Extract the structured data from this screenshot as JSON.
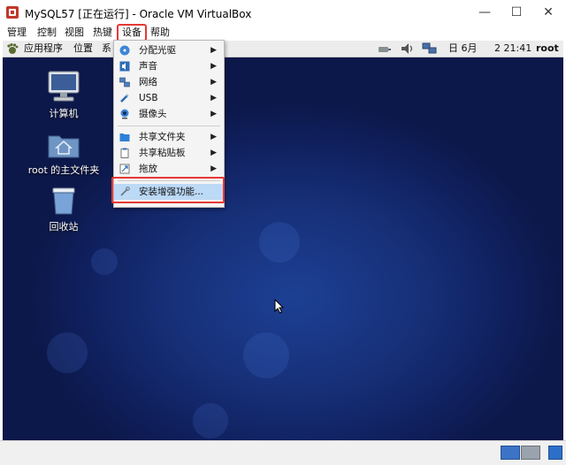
{
  "window": {
    "title": "MySQL57 [正在运行] - Oracle VM VirtualBox",
    "minimize": "—",
    "maximize": "☐",
    "close": "✕"
  },
  "vbox_menu": [
    "管理",
    "控制",
    "视图",
    "热键",
    "设备",
    "帮助"
  ],
  "guest_panel": {
    "apps": "应用程序",
    "places": "位置",
    "system": "系",
    "date": "日 6月",
    "time": "2 21:41",
    "user": "root"
  },
  "desktop_icons": [
    {
      "label": "计算机",
      "icon": "computer-icon"
    },
    {
      "label": "root 的主文件夹",
      "icon": "home-folder-icon"
    },
    {
      "label": "回收站",
      "icon": "trash-icon"
    }
  ],
  "devices_menu": {
    "items": [
      {
        "label": "分配光驱",
        "icon": "optical-drive-icon",
        "submenu": true
      },
      {
        "label": "声音",
        "icon": "audio-icon",
        "submenu": true
      },
      {
        "label": "网络",
        "icon": "network-icon",
        "submenu": true
      },
      {
        "label": "USB",
        "icon": "usb-icon",
        "submenu": true
      },
      {
        "label": "摄像头",
        "icon": "webcam-icon",
        "submenu": true
      },
      {
        "label": "共享文件夹",
        "icon": "shared-folder-icon",
        "submenu": true
      },
      {
        "label": "共享粘贴板",
        "icon": "clipboard-icon",
        "submenu": true
      },
      {
        "label": "拖放",
        "icon": "drag-drop-icon",
        "submenu": true
      },
      {
        "label": "安装增强功能...",
        "icon": "install-icon",
        "submenu": false
      }
    ],
    "arrow": "▶"
  },
  "colors": {
    "highlight_red": "#e53935",
    "menu_selection": "#bcd9f6",
    "desktop_blue": "#17317a"
  }
}
